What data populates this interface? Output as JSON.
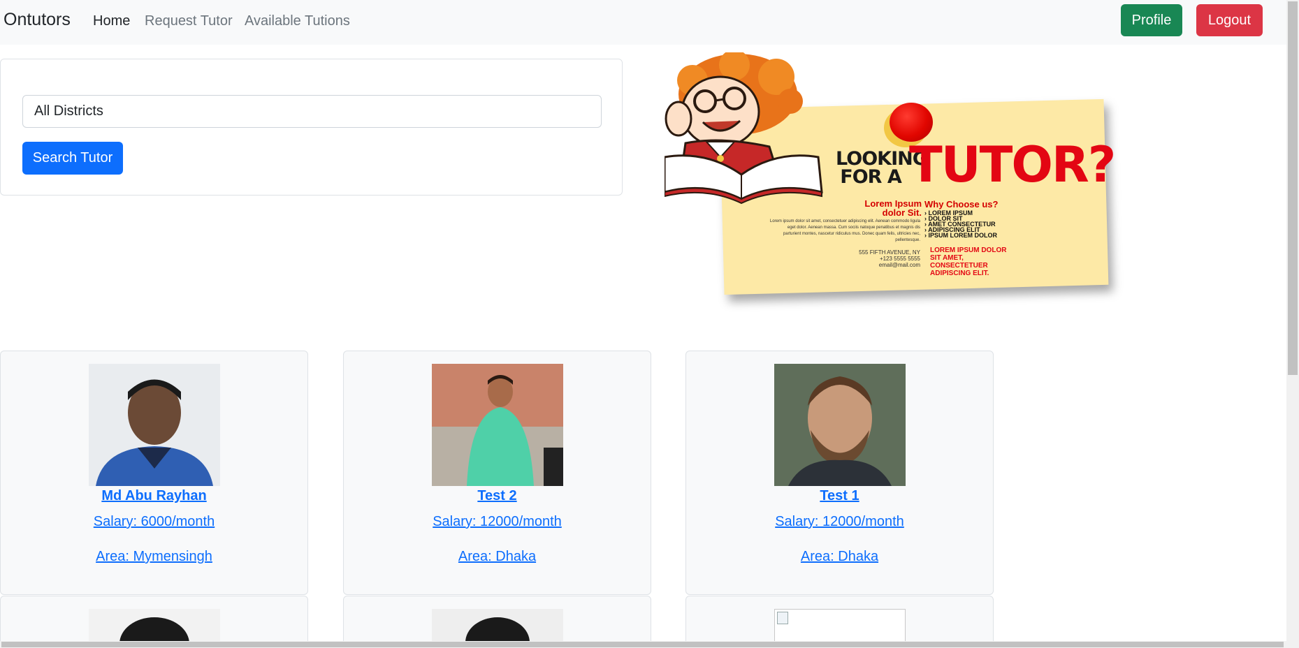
{
  "navbar": {
    "brand": "Ontutors",
    "links": [
      "Home",
      "Request Tutor",
      "Available Tutions"
    ],
    "profile_label": "Profile",
    "logout_label": "Logout"
  },
  "search": {
    "district_value": "All Districts",
    "button_label": "Search Tutor"
  },
  "poster": {
    "line1": "LOOKING",
    "line2": "FOR A",
    "headline": "TUTOR?",
    "lorem_head": "Lorem Ipsum dolor Sit.",
    "why_head": "Why Choose us?",
    "body": "Lorem ipsum dolor sit amet, consectetuer adipiscing elit. Aenean commodo ligula eget dolor. Aenean massa. Cum sociis natoque penatibus et magnis dis parturient montes, nascetur ridiculus mus. Donec quam felis, ultricies nec, pellentesque.",
    "list": [
      "LOREM IPSUM",
      "DOLOR SIT",
      "AMET CONSECTETUR",
      "ADIPISCING ELIT",
      "IPSUM LOREM DOLOR"
    ],
    "address": [
      "555 FIFTH AVENUE, NY",
      "+123 5555 5555",
      "email@mail.com"
    ],
    "red_text": "LOREM IPSUM DOLOR SIT AMET, CONSECTETUER ADIPISCING ELIT."
  },
  "tutors": [
    {
      "name": "Md Abu Rayhan",
      "salary": "Salary: 6000/month",
      "area": "Area: Mymensingh"
    },
    {
      "name": "Test 2",
      "salary": "Salary: 12000/month",
      "area": "Area: Dhaka"
    },
    {
      "name": "Test 1",
      "salary": "Salary: 12000/month",
      "area": "Area: Dhaka"
    }
  ],
  "colors": {
    "primary": "#0d6efd",
    "success": "#198754",
    "danger": "#dc3545",
    "navbar_bg": "#f8f9fa"
  }
}
